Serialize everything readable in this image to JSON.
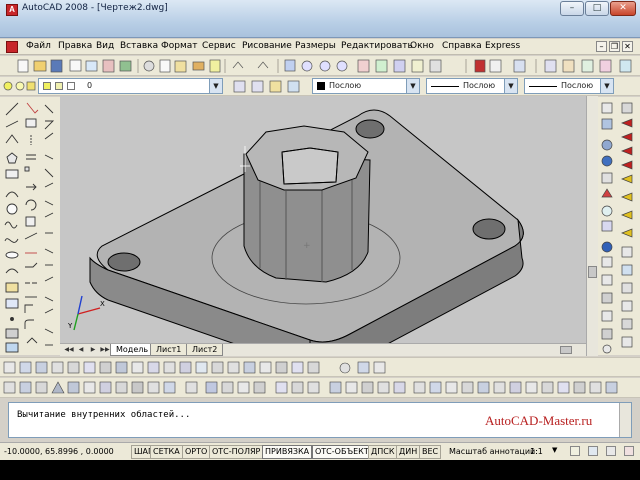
{
  "window": {
    "title": "AutoCAD 2008 - [Чертеж2.dwg]",
    "min": "–",
    "max": "□",
    "close": "✕"
  },
  "menu": [
    "Файл",
    "Правка",
    "Вид",
    "Вставка",
    "Формат",
    "Сервис",
    "Рисование",
    "Размеры",
    "Редактировать",
    "Окно",
    "Справка",
    "Express"
  ],
  "layers": {
    "current_layer": "0",
    "color": "Послою",
    "linetype": "Послою",
    "lineweight": "Послою"
  },
  "layout_tabs": [
    "Модель",
    "Лист1",
    "Лист2"
  ],
  "command_line": {
    "text": "Вычитание внутренних областей...",
    "watermark": "AutoCAD-Master.ru"
  },
  "status": {
    "coords": "-10.0000, 65.8996 , 0.0000",
    "buttons": [
      "ШАГ",
      "СЕТКА",
      "ОРТО",
      "ОТС-ПОЛЯР",
      "ПРИВЯЗКА",
      "ОТС-ОБЪЕКТ",
      "ДПСК",
      "ДИН",
      "ВЕС"
    ],
    "scale_label": "Масштаб аннотаций:",
    "scale_value": "1:1"
  },
  "ucs": {
    "x": "X",
    "y": "Y"
  },
  "colors": {
    "model_shade": "#8a8a8a",
    "model_light": "#b0b0b0",
    "background": "#c6c6c6",
    "accent": "#c8262a"
  }
}
